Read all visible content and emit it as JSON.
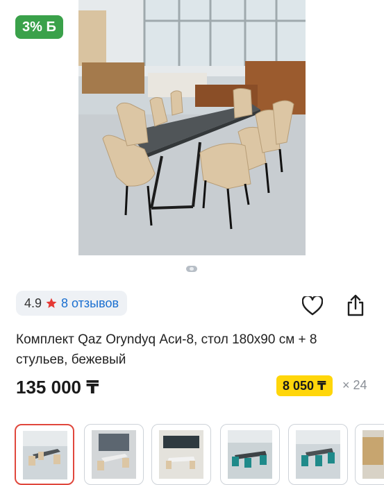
{
  "product": {
    "bonus_badge": "3% Б",
    "rating": "4.9",
    "reviews_link": "8 отзывов",
    "title": "Комплект Qaz Oryndyq Аси-8, стол 180x90 см + 8 стульев, бежевый",
    "price": "135 000 ₸",
    "installment": {
      "amount": "8 050 ₸",
      "term": "× 24"
    }
  },
  "gallery": {
    "thumbnails": [
      {
        "selected": true
      },
      {
        "selected": false
      },
      {
        "selected": false
      },
      {
        "selected": false
      },
      {
        "selected": false
      },
      {
        "selected": false
      }
    ]
  },
  "colors": {
    "bonus": "#3aa14a",
    "installment": "#ffd60a",
    "link": "#1a6fd0",
    "star": "#e53935",
    "selected_border": "#e0473c"
  },
  "icons": {
    "favorite": "heart-icon",
    "share": "share-icon",
    "rating": "star-icon"
  }
}
